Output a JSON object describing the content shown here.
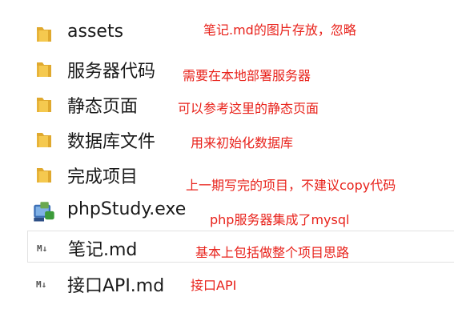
{
  "files": [
    {
      "name": "assets",
      "icon": "folder-icon",
      "note": "笔记.md的图片存放，忽略"
    },
    {
      "name": "服务器代码",
      "icon": "folder-icon",
      "note": "需要在本地部署服务器"
    },
    {
      "name": "静态页面",
      "icon": "folder-icon",
      "note": "可以参考这里的静态页面"
    },
    {
      "name": "数据库文件",
      "icon": "folder-icon",
      "note": "用来初始化数据库"
    },
    {
      "name": "完成项目",
      "icon": "folder-icon",
      "note": "上一期写完的项目，不建议copy代码"
    },
    {
      "name": "phpStudy.exe",
      "icon": "phpstudy-exe-icon",
      "note": "php服务器集成了mysql"
    },
    {
      "name": "笔记.md",
      "icon": "markdown-file-icon",
      "note": "基本上包括做整个项目思路"
    },
    {
      "name": "接口API.md",
      "icon": "markdown-file-icon",
      "note": "接口API"
    }
  ],
  "colors": {
    "folder": "#f2c14e",
    "annotation": "#e8221b"
  }
}
